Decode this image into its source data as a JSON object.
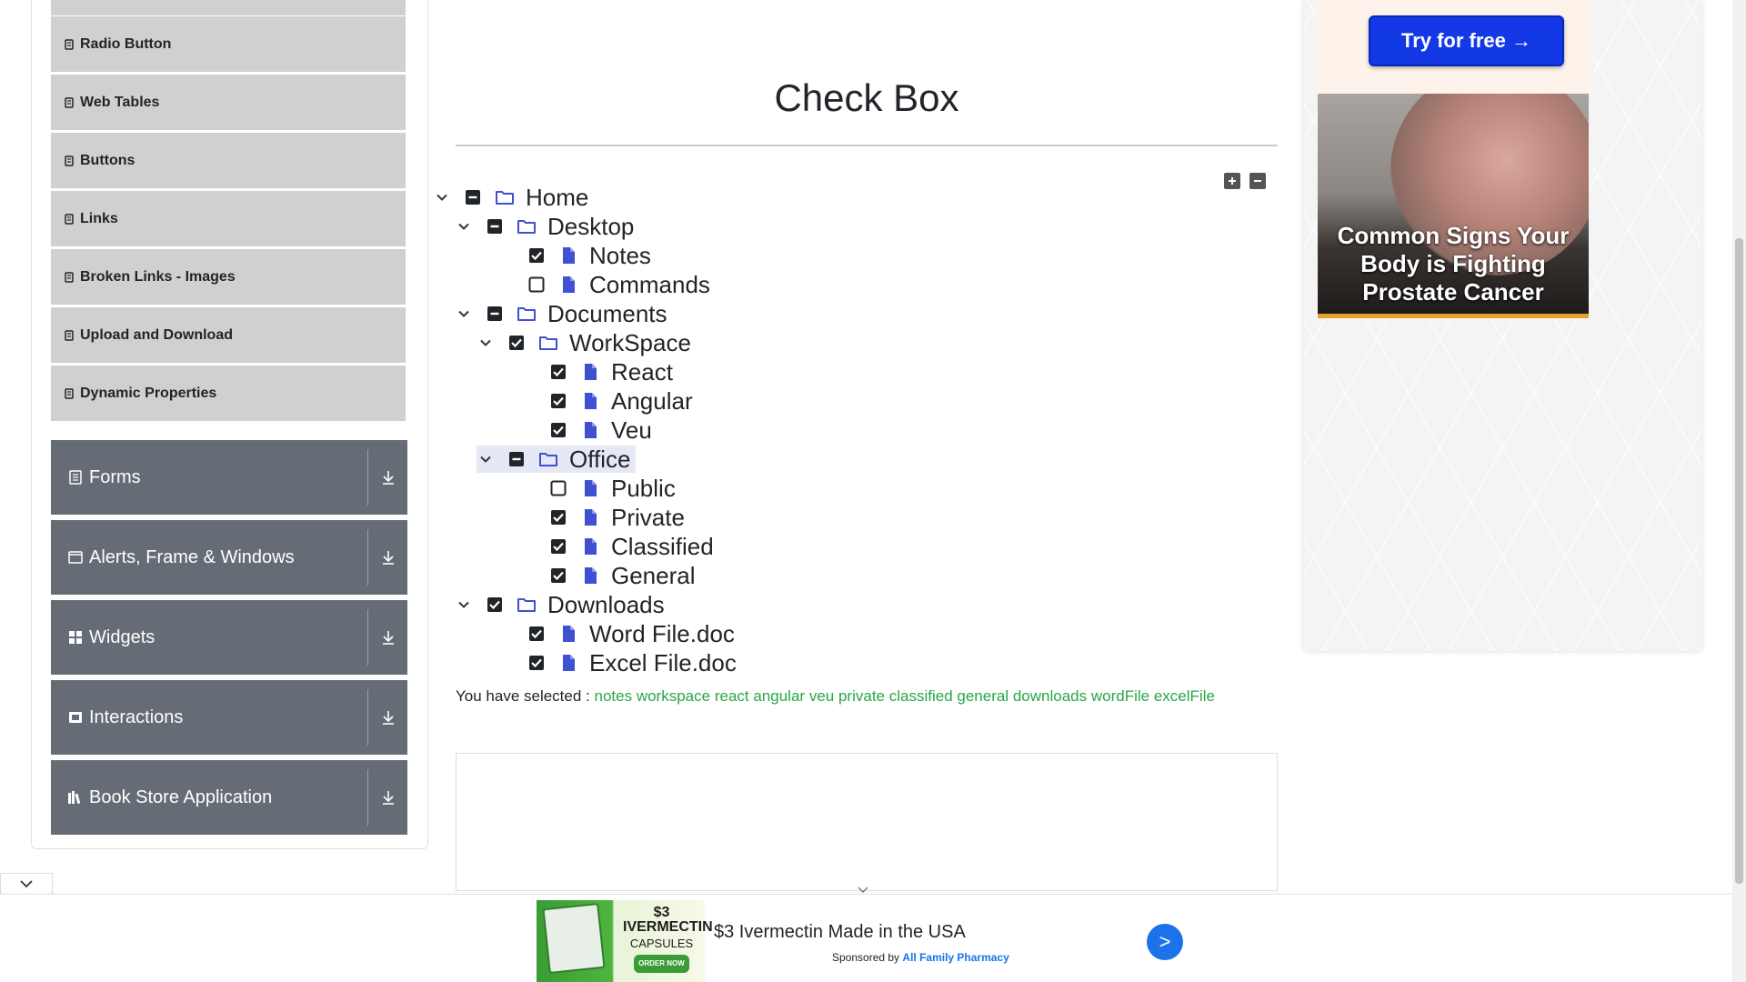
{
  "sidebar": {
    "elements_items": [
      {
        "label": "Radio Button"
      },
      {
        "label": "Web Tables"
      },
      {
        "label": "Buttons"
      },
      {
        "label": "Links"
      },
      {
        "label": "Broken Links - Images"
      },
      {
        "label": "Upload and Download"
      },
      {
        "label": "Dynamic Properties"
      }
    ],
    "groups": [
      {
        "label": "Forms",
        "icon": "form-icon"
      },
      {
        "label": "Alerts, Frame & Windows",
        "icon": "window-icon"
      },
      {
        "label": "Widgets",
        "icon": "widgets-icon"
      },
      {
        "label": "Interactions",
        "icon": "interactions-icon"
      },
      {
        "label": "Book Store Application",
        "icon": "book-icon"
      }
    ]
  },
  "main": {
    "title": "Check Box",
    "tree": {
      "home": {
        "label": "Home",
        "state": "partial"
      },
      "desktop": {
        "label": "Desktop",
        "state": "partial"
      },
      "notes": {
        "label": "Notes",
        "state": "checked"
      },
      "commands": {
        "label": "Commands",
        "state": "unchecked"
      },
      "documents": {
        "label": "Documents",
        "state": "partial"
      },
      "workspace": {
        "label": "WorkSpace",
        "state": "checked"
      },
      "react": {
        "label": "React",
        "state": "checked"
      },
      "angular": {
        "label": "Angular",
        "state": "checked"
      },
      "veu": {
        "label": "Veu",
        "state": "checked"
      },
      "office": {
        "label": "Office",
        "state": "partial"
      },
      "public": {
        "label": "Public",
        "state": "unchecked"
      },
      "private": {
        "label": "Private",
        "state": "checked"
      },
      "classified": {
        "label": "Classified",
        "state": "checked"
      },
      "general": {
        "label": "General",
        "state": "checked"
      },
      "downloads": {
        "label": "Downloads",
        "state": "checked"
      },
      "wordfile": {
        "label": "Word File.doc",
        "state": "checked"
      },
      "excelfile": {
        "label": "Excel File.doc",
        "state": "checked"
      }
    },
    "result_prefix": "You have selected :",
    "selected": [
      "notes",
      "workspace",
      "react",
      "angular",
      "veu",
      "private",
      "classified",
      "general",
      "downloads",
      "wordFile",
      "excelFile"
    ]
  },
  "right_ad": {
    "cta": "Try for free →",
    "headline": "Common Signs Your Body is Fighting Prostate Cancer"
  },
  "bottom_ad": {
    "image_price": "$3",
    "image_name": "IVERMECTIN",
    "image_sub": "CAPSULES",
    "image_order": "ORDER NOW",
    "title": "$3 Ivermectin Made in the USA",
    "sponsored_prefix": "Sponsored by",
    "sponsor": "All Family Pharmacy",
    "go": ">"
  },
  "colors": {
    "accent_blue": "#1339e6",
    "selected_green": "#28a745",
    "group_bg": "#666c75",
    "item_bg": "#d0d0d0"
  }
}
